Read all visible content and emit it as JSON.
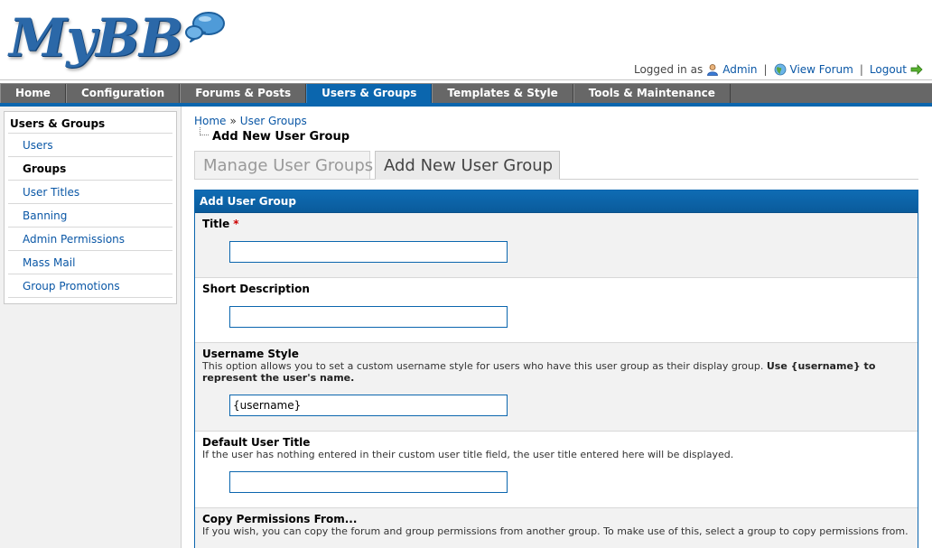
{
  "header": {
    "logo_text": "MyBB",
    "logged_in_as": "Logged in as",
    "user_link": "Admin",
    "view_forum_link": "View Forum",
    "logout_link": "Logout",
    "separator": "|"
  },
  "nav": {
    "tabs": [
      {
        "label": "Home",
        "active": false
      },
      {
        "label": "Configuration",
        "active": false
      },
      {
        "label": "Forums & Posts",
        "active": false
      },
      {
        "label": "Users & Groups",
        "active": true
      },
      {
        "label": "Templates & Style",
        "active": false
      },
      {
        "label": "Tools & Maintenance",
        "active": false
      }
    ]
  },
  "sidebar": {
    "title": "Users & Groups",
    "items": [
      {
        "label": "Users"
      },
      {
        "label": "Groups"
      },
      {
        "label": "User Titles"
      },
      {
        "label": "Banning"
      },
      {
        "label": "Admin Permissions"
      },
      {
        "label": "Mass Mail"
      },
      {
        "label": "Group Promotions"
      }
    ],
    "active_item": "Groups"
  },
  "breadcrumb": {
    "home": "Home",
    "sep": "»",
    "section": "User Groups"
  },
  "page_title": "Add New User Group",
  "subtabs": {
    "manage": "Manage User Groups",
    "add": "Add New User Group"
  },
  "form": {
    "header": "Add User Group",
    "title": {
      "label": "Title",
      "required_mark": "*",
      "value": ""
    },
    "short_description": {
      "label": "Short Description",
      "value": ""
    },
    "username_style": {
      "label": "Username Style",
      "desc": "This option allows you to set a custom username style for users who have this user group as their display group.",
      "desc_bold": "Use {username} to represent the user's name.",
      "value": "{username}"
    },
    "default_user_title": {
      "label": "Default User Title",
      "desc": "If the user has nothing entered in their custom user title field, the user title entered here will be displayed.",
      "value": ""
    },
    "copy_permissions": {
      "label": "Copy Permissions From...",
      "desc": "If you wish, you can copy the forum and group permissions from another group. To make use of this, select a group to copy permissions from."
    }
  },
  "colors": {
    "accent_blue": "#0b66ae",
    "nav_gray": "#676767",
    "link_blue": "#0a57a6",
    "required_red": "#cc0000"
  }
}
